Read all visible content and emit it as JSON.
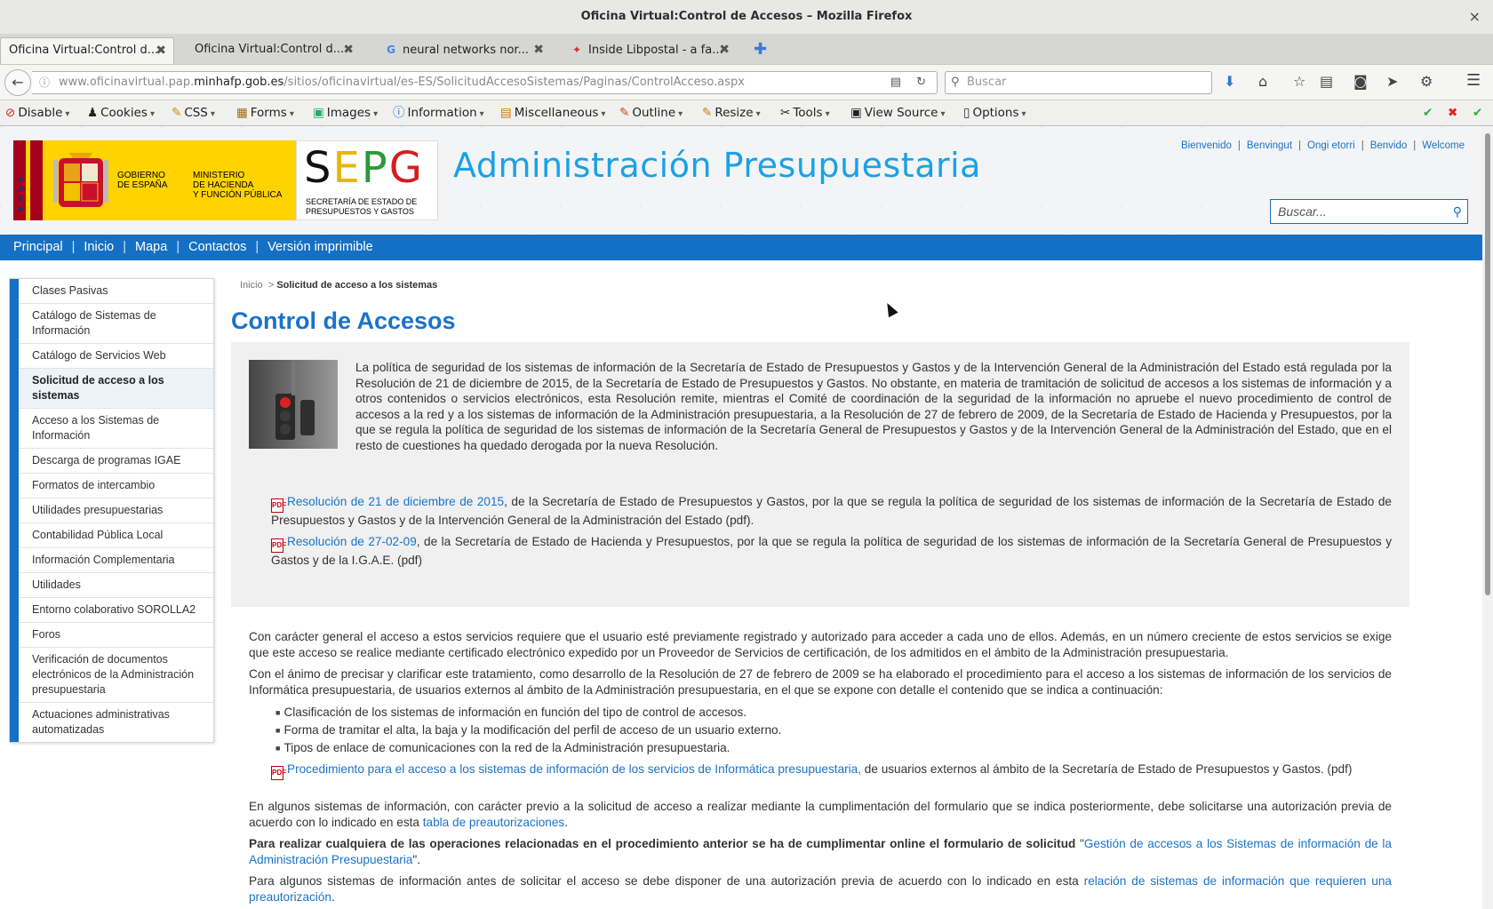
{
  "window": {
    "title": "Oficina Virtual:Control de Accesos – Mozilla Firefox",
    "close": "×"
  },
  "tabs": [
    {
      "label": "Oficina Virtual:Control d...",
      "icon": "",
      "active": true
    },
    {
      "label": "Oficina Virtual:Control d...",
      "icon": "",
      "active": false
    },
    {
      "label": "neural networks nor...",
      "icon": "G",
      "active": false
    },
    {
      "label": "Inside Libpostal - a fa...",
      "icon": "✦",
      "active": false
    }
  ],
  "newtab": "✚",
  "urlbar": {
    "prefix": "www.oficinavirtual.pap.",
    "host": "minhafp.gob.es",
    "path": "/sitios/oficinavirtual/es-ES/SolicitudAccesoSistemas/Paginas/ControlAcceso.aspx"
  },
  "searchbar": {
    "placeholder": "Buscar"
  },
  "devbar": [
    {
      "label": "Disable",
      "icon": "⊘",
      "color": "#d22"
    },
    {
      "label": "Cookies",
      "icon": "👤",
      "color": "#222"
    },
    {
      "label": "CSS",
      "icon": "✎",
      "color": "#c80"
    },
    {
      "label": "Forms",
      "icon": "📋",
      "color": "#a60"
    },
    {
      "label": "Images",
      "icon": "▣",
      "color": "#2a6"
    },
    {
      "label": "Information",
      "icon": "ⓘ",
      "color": "#26c"
    },
    {
      "label": "Miscellaneous",
      "icon": "▤",
      "color": "#c70"
    },
    {
      "label": "Outline",
      "icon": "✎",
      "color": "#c40"
    },
    {
      "label": "Resize",
      "icon": "✎",
      "color": "#c70"
    },
    {
      "label": "Tools",
      "icon": "✂",
      "color": "#333"
    },
    {
      "label": "View Source",
      "icon": "▣",
      "color": "#333"
    },
    {
      "label": "Options",
      "icon": "▯",
      "color": "#333"
    }
  ],
  "header": {
    "gov_logo_line1": "GOBIERNO",
    "gov_logo_line2": "DE ESPAÑA",
    "ministry_line1": "MINISTERIO",
    "ministry_line2": "DE HACIENDA",
    "ministry_line3": "Y FUNCIÓN PÚBLICA",
    "sepg_letters": [
      "S",
      "E",
      "P",
      "G"
    ],
    "sepg_sub1": "SECRETARÍA DE ESTADO DE",
    "sepg_sub2": "PRESUPUESTOS Y GASTOS",
    "title": "Administración Presupuestaria",
    "languages": [
      "Bienvenido",
      "Benvingut",
      "Ongi etorri",
      "Benvido",
      "Welcome"
    ],
    "search_placeholder": "Buscar..."
  },
  "topnav": [
    "Principal",
    "Inicio",
    "Mapa",
    "Contactos",
    "Versión imprimible"
  ],
  "sidebar": [
    {
      "label": "Clases Pasivas",
      "active": false
    },
    {
      "label": "Catálogo de Sistemas de Información",
      "active": false
    },
    {
      "label": "Catálogo de Servicios Web",
      "active": false
    },
    {
      "label": "Solicitud de acceso a los sistemas",
      "active": true
    },
    {
      "label": "Acceso a los Sistemas de Información",
      "active": false
    },
    {
      "label": "Descarga de programas IGAE",
      "active": false
    },
    {
      "label": "Formatos de intercambio",
      "active": false
    },
    {
      "label": "Utilidades presupuestarias",
      "active": false
    },
    {
      "label": "Contabilidad Pública Local",
      "active": false
    },
    {
      "label": "Información Complementaria",
      "active": false
    },
    {
      "label": "Utilidades",
      "active": false
    },
    {
      "label": "Entorno colaborativo SOROLLA2",
      "active": false
    },
    {
      "label": "Foros",
      "active": false
    },
    {
      "label": "Verificación de documentos electrónicos de la Administración presupuestaria",
      "active": false
    },
    {
      "label": "Actuaciones administrativas automatizadas",
      "active": false
    }
  ],
  "breadcrumb": {
    "home": "Inicio",
    "sep": ">",
    "current": "Solicitud de acceso a los sistemas"
  },
  "main": {
    "title": "Control de Accesos",
    "intro": "La política de seguridad de los sistemas de información de la Secretaría de Estado de Presupuestos y Gastos y de la Intervención General de la Administración del Estado está regulada por la Resolución de 21 de diciembre de 2015, de la Secretaría de Estado de Presupuestos y Gastos. No obstante, en materia de tramitación de solicitud de accesos a los sistemas de información y a otros contenidos o servicios electrónicos, esta Resolución remite, mientras el Comité de coordinación de la seguridad de la información no apruebe el nuevo procedimiento de control de accesos a la red y a los sistemas de información de la Administración presupuestaria, a la Resolución de 27 de febrero de 2009, de la Secretaría de Estado de Hacienda y Presupuestos, por la que se regula la política de seguridad de los sistemas de información de la Secretaría General de Presupuestos y Gastos y de la Intervención General de la Administración del Estado, que en el resto de cuestiones ha quedado derogada por la nueva Resolución.",
    "doc1_link": "Resolución de 21 de diciembre de 2015",
    "doc1_text": ", de la Secretaría de Estado de Presupuestos y Gastos, por la que se regula la política de seguridad de los sistemas de información de la Secretaría de Estado de Presupuestos y Gastos y de la Intervención General de la Administración del Estado (pdf).",
    "doc2_link": "Resolución de 27-02-09",
    "doc2_text": ", de la Secretaría de Estado de Hacienda y Presupuestos, por la que se regula la política de seguridad de los sistemas de información de la Secretaría General de Presupuestos y Gastos y de la I.G.A.E. (pdf)",
    "para1": "Con carácter general el acceso a estos servicios requiere que el usuario esté previamente registrado y autorizado para acceder a cada uno de ellos. Además, en un número creciente de estos servicios se exige que este acceso se realice mediante certificado electrónico expedido por un Proveedor de Servicios de certificación, de los admitidos en el ámbito de la Administración presupuestaria.",
    "para2": "Con el ánimo de precisar y clarificar este tratamiento, como desarrollo de la Resolución de 27 de febrero de 2009 se ha elaborado el procedimiento para el acceso a los sistemas de información de los servicios de Informática presupuestaria, de usuarios externos al ámbito de la Administración presupuestaria, en el que se expone con detalle el contenido que se indica a continuación:",
    "bullets": [
      "Clasificación de los sistemas de información en función del tipo de control de accesos.",
      "Forma de tramitar el alta, la baja y la modificación del perfil de acceso de un usuario externo.",
      "Tipos de enlace de comunicaciones con la red de la Administración presupuestaria."
    ],
    "doc3_link": "Procedimiento para el acceso a los sistemas de información de los servicios de Informática presupuestaria,",
    "doc3_text": " de usuarios externos al ámbito de la Secretaría de Estado de Presupuestos y Gastos. (pdf)",
    "para3_text": "En algunos sistemas de información, con carácter previo a la solicitud de acceso a realizar mediante la cumplimentación del formulario que se indica posteriormente, debe solicitarse una autorización previa de acuerdo con lo indicado en esta ",
    "para3_link": "tabla de preautorizaciones",
    "para3_end": ".",
    "para4_bold": "Para realizar cualquiera de las operaciones relacionadas en el procedimiento anterior se ha de cumplimentar online el formulario de solicitud",
    "para4_quote_open": " \"",
    "para4_link": "Gestión de accesos a los Sistemas de información de la Administración Presupuestaria",
    "para4_end": "\".",
    "para5_text": "Para algunos sistemas de información antes de solicitar el acceso se debe disponer de una autorización previa de acuerdo con lo indicado en esta ",
    "para5_link": "relación de sistemas de información que requieren una preautorización",
    "para5_end": "."
  }
}
